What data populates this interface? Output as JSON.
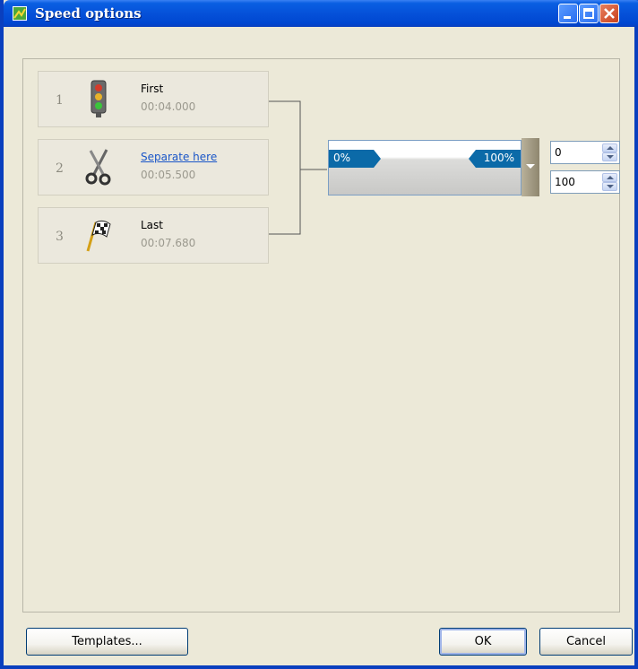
{
  "window": {
    "title": "Speed options"
  },
  "segments": [
    {
      "index": "1",
      "name": "First",
      "time": "00:04.000",
      "icon": "traffic-light-icon"
    },
    {
      "index": "2",
      "name": "Separate here",
      "time": "00:05.500",
      "icon": "scissors-icon"
    },
    {
      "index": "3",
      "name": "Last",
      "time": "00:07.680",
      "icon": "checkered-flag-icon"
    }
  ],
  "speed_range": {
    "start_label": "0%",
    "end_label": "100%"
  },
  "inputs": {
    "start_value": "0",
    "end_value": "100"
  },
  "buttons": {
    "templates": "Templates...",
    "ok": "OK",
    "cancel": "Cancel"
  },
  "colors": {
    "title_bar": "#0551d9",
    "range_tab": "#0b6aa8",
    "link": "#1a56c8"
  }
}
